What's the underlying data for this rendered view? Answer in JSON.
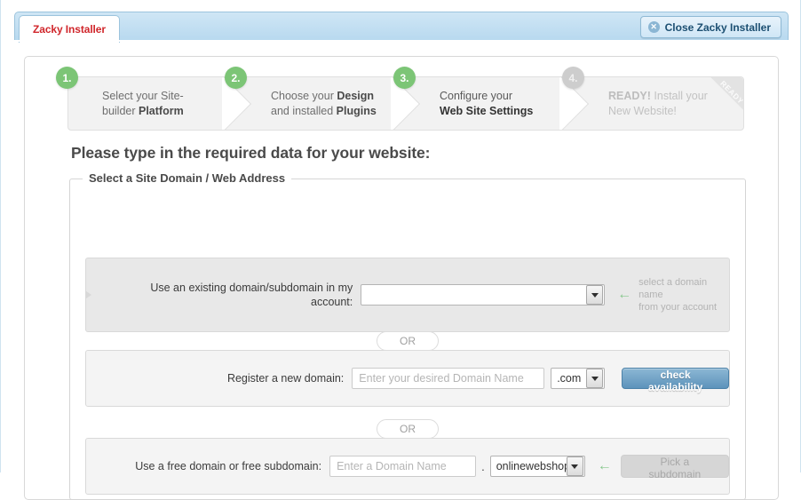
{
  "window": {
    "tab_label": "Zacky Installer",
    "close_button_label": "Close Zacky Installer",
    "close_icon": "close-circle-icon",
    "accent_red": "#d0262b",
    "accent_blue": "#1c4f72",
    "accent_green": "#7cc576"
  },
  "steps": [
    {
      "number": "1.",
      "line1": "Select your Site-",
      "line2_plain": "builder ",
      "line2_bold": "Platform",
      "state": "done"
    },
    {
      "number": "2.",
      "line1_plain": "Choose your ",
      "line1_bold": "Design",
      "line2_plain": "and installed ",
      "line2_bold": "Plugins",
      "state": "done"
    },
    {
      "number": "3.",
      "line1": "Configure your",
      "line2_bold": "Web Site Settings",
      "state": "active"
    },
    {
      "number": "4.",
      "line1_bold": "READY!",
      "line1_plain": " Install your",
      "line2": "New Website!",
      "state": "disabled",
      "ribbon_label": "READY"
    }
  ],
  "main": {
    "heading": "Please type in the required data for your website:",
    "fieldset_legend": "Select a Site Domain / Web Address",
    "or_label_1": "OR",
    "or_label_2": "OR"
  },
  "existing_domain": {
    "label_line1": "Use an existing domain/subdomain in my",
    "label_line2": "account:",
    "select_value": "",
    "hint_arrow": "arrow-left-icon",
    "hint_line1": "select a domain name",
    "hint_line2": "from your account"
  },
  "register_domain": {
    "label": "Register a new domain:",
    "input_value": "",
    "input_placeholder": "Enter your desired Domain Name",
    "tld_value": ".com",
    "button_label": "check availability"
  },
  "free_domain": {
    "label": "Use a free domain or free subdomain:",
    "input_value": "",
    "input_placeholder": "Enter a Domain Name",
    "separator": ".",
    "suffix_value": "onlinewebshop.",
    "hint_arrow": "arrow-left-icon",
    "button_label": "Pick a subdomain"
  }
}
